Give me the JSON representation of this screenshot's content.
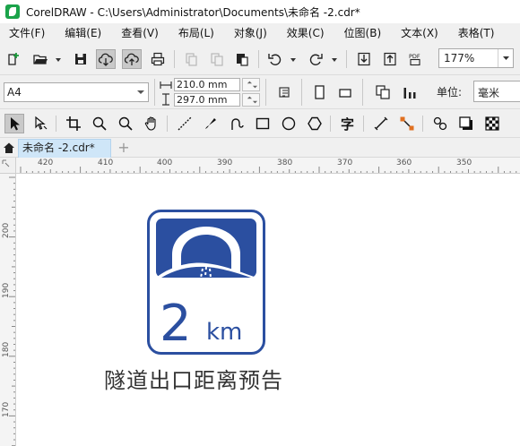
{
  "window": {
    "title": "CorelDRAW - C:\\Users\\Administrator\\Documents\\未命名 -2.cdr*"
  },
  "menu": [
    "文件(F)",
    "编辑(E)",
    "查看(V)",
    "布局(L)",
    "对象(J)",
    "效果(C)",
    "位图(B)",
    "文本(X)",
    "表格(T)"
  ],
  "toolbar": {
    "zoom_value": "177%",
    "pdf_label": "PDF"
  },
  "property_bar": {
    "paper_size": "A4",
    "width": "210.0 mm",
    "height": "297.0 mm",
    "units_label": "单位:",
    "units_value": "毫米"
  },
  "document_tab": {
    "name": "未命名 -2.cdr*",
    "add_symbol": "+"
  },
  "rulers": {
    "horizontal": [
      "420",
      "410",
      "400",
      "390",
      "380",
      "370",
      "360",
      "350"
    ],
    "vertical": [
      "200",
      "190",
      "180",
      "170"
    ]
  },
  "sign": {
    "distance_number": "2",
    "distance_unit": "km",
    "caption": "隧道出口距离预告",
    "color": "#2b4fa0"
  }
}
